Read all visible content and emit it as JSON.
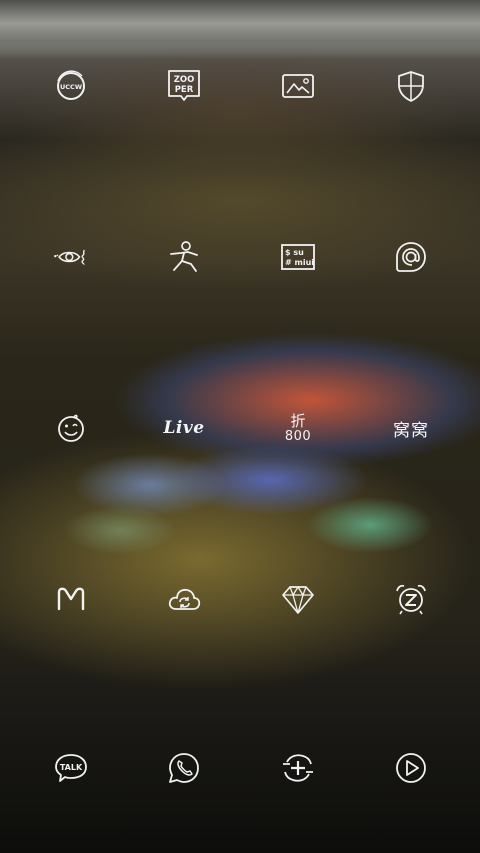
{
  "screen": "home-icon-grid",
  "icon_color": "#f2f2f2",
  "icons": [
    {
      "name": "uccw",
      "text": "UCCW"
    },
    {
      "name": "zooper",
      "text_line1": "ZOO",
      "text_line2": "PER"
    },
    {
      "name": "gallery"
    },
    {
      "name": "security-shield"
    },
    {
      "name": "eye-widget"
    },
    {
      "name": "running-man"
    },
    {
      "name": "superuser",
      "text_line1": "$ su",
      "text_line2": "# miui"
    },
    {
      "name": "at-sign"
    },
    {
      "name": "smiley"
    },
    {
      "name": "live",
      "text": "Live"
    },
    {
      "name": "zhe800",
      "text_line1": "折",
      "text_line2": "800"
    },
    {
      "name": "wowo",
      "text": "窝窝"
    },
    {
      "name": "gmail-m",
      "text": "M"
    },
    {
      "name": "cloud-sync"
    },
    {
      "name": "diamond"
    },
    {
      "name": "alarm-clock"
    },
    {
      "name": "kakaotalk",
      "text": "TALK"
    },
    {
      "name": "whatsapp-phone"
    },
    {
      "name": "circle-plus-arrows"
    },
    {
      "name": "play"
    }
  ]
}
